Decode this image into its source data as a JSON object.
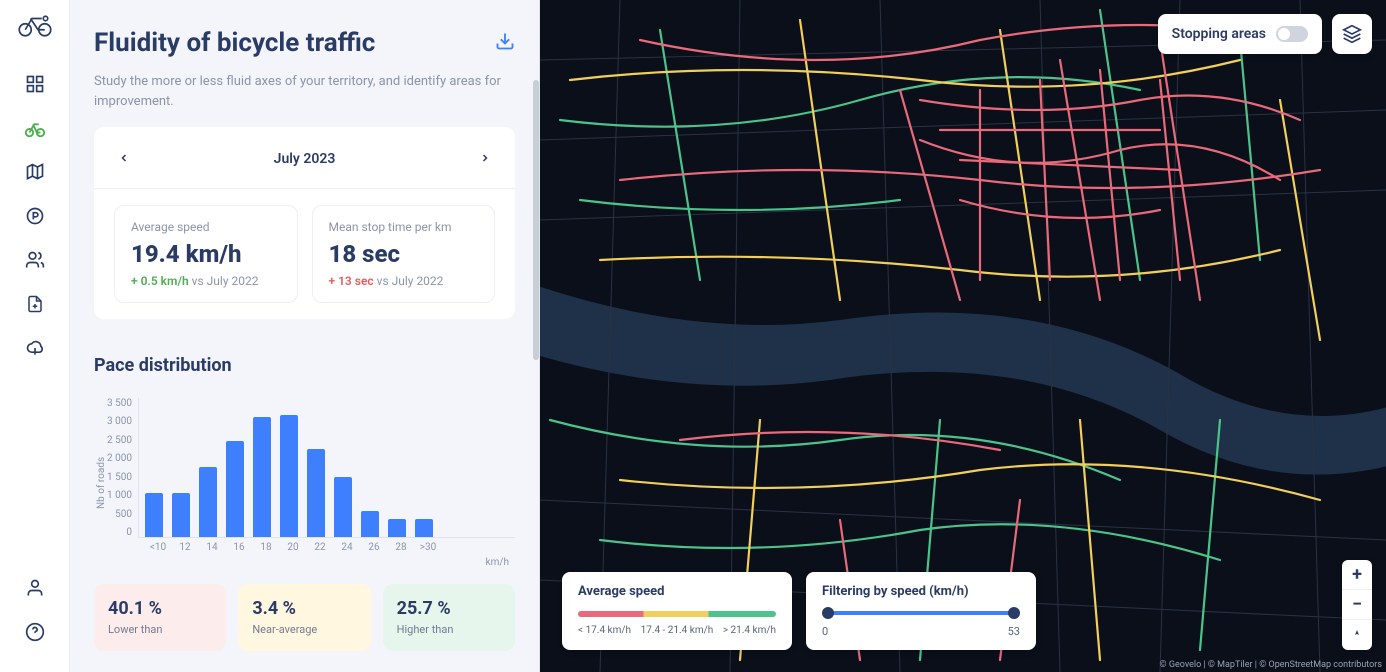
{
  "panel": {
    "title": "Fluidity of bicycle traffic",
    "description": "Study the more or less fluid axes of your territory, and identify areas for improvement.",
    "month": "July 2023"
  },
  "stats": {
    "avg_speed": {
      "label": "Average speed",
      "value": "19.4 km/h",
      "delta": "+ 0.5 km/h",
      "delta_suffix": " vs July 2022"
    },
    "stop_time": {
      "label": "Mean stop time per km",
      "value": "18 sec",
      "delta": "+ 13 sec",
      "delta_suffix": " vs July 2022"
    }
  },
  "pace_title": "Pace distribution",
  "chart_data": {
    "type": "bar",
    "title": "Pace distribution",
    "xlabel": "km/h",
    "ylabel": "Nb of roads",
    "ylim": [
      0,
      3500
    ],
    "yticks": [
      "3 500",
      "3 000",
      "2 500",
      "2 000",
      "1 500",
      "1 000",
      "500",
      "0"
    ],
    "categories": [
      "<10",
      "12",
      "14",
      "16",
      "18",
      "20",
      "22",
      "24",
      "26",
      "28",
      ">30"
    ],
    "values": [
      1100,
      1100,
      1750,
      2400,
      3000,
      3050,
      2200,
      1500,
      650,
      450,
      450
    ]
  },
  "summary": {
    "low": {
      "value": "40.1 %",
      "label": "Lower than"
    },
    "avg": {
      "value": "3.4 %",
      "label": "Near-average"
    },
    "high": {
      "value": "25.7 %",
      "label": "Higher than"
    }
  },
  "map": {
    "stopping_areas_label": "Stopping areas",
    "legend": {
      "title": "Average speed",
      "low": "< 17.4 km/h",
      "mid": "17.4 - 21.4 km/h",
      "high": "> 21.4 km/h"
    },
    "filter": {
      "title": "Filtering by speed (km/h)",
      "min": "0",
      "max": "53"
    },
    "attribution": "© Geovelo | © MapTiler | © OpenStreetMap contributors"
  }
}
